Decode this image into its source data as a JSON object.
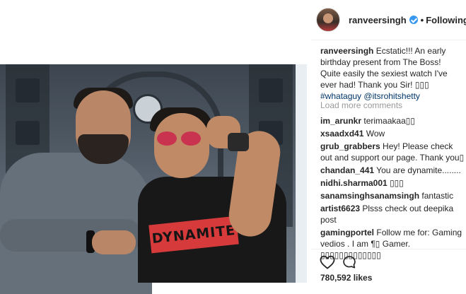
{
  "post": {
    "author": "ranveersingh",
    "follow_separator": "•",
    "follow_status": "Following",
    "verified_color": "#3897f0"
  },
  "caption": {
    "user": "ranveersingh",
    "text": "Ecstatic!!! An early birthday present from The Boss! Quite easily the sexiest watch I've ever had! Thank you Sir! ",
    "emojis": "▯▯▯",
    "hashtag": "#whataguy",
    "mention": "@itsrohitshetty"
  },
  "load_more_label": "Load more comments",
  "comments": [
    {
      "user": "im_arunkr",
      "text": "terimaakaa▯▯"
    },
    {
      "user": "xsaadxd41",
      "text": "Wow"
    },
    {
      "user": "grub_grabbers",
      "text": "Hey! Please check out and support our page. Thank you▯"
    },
    {
      "user": "chandan_441",
      "text": "You are dynamite........"
    },
    {
      "user": "nidhi.sharma001",
      "text": "▯▯▯"
    },
    {
      "user": "sanamsinghsanamsingh",
      "text": "fantastic"
    },
    {
      "user": "artist6623",
      "text": "Plsss check out deepika post"
    },
    {
      "user": "gamingportel",
      "text": "Follow me for: Gaming vedios . I am ¶▯ Gamer. ▯▯▯▯▯▯▯▯▯▯▯▯▯"
    }
  ],
  "photo": {
    "shirt_print": "DYNAMITE"
  },
  "actions": {
    "like_icon": "heart-icon",
    "comment_icon": "comment-bubble-icon"
  },
  "likes_label": "780,592 likes"
}
